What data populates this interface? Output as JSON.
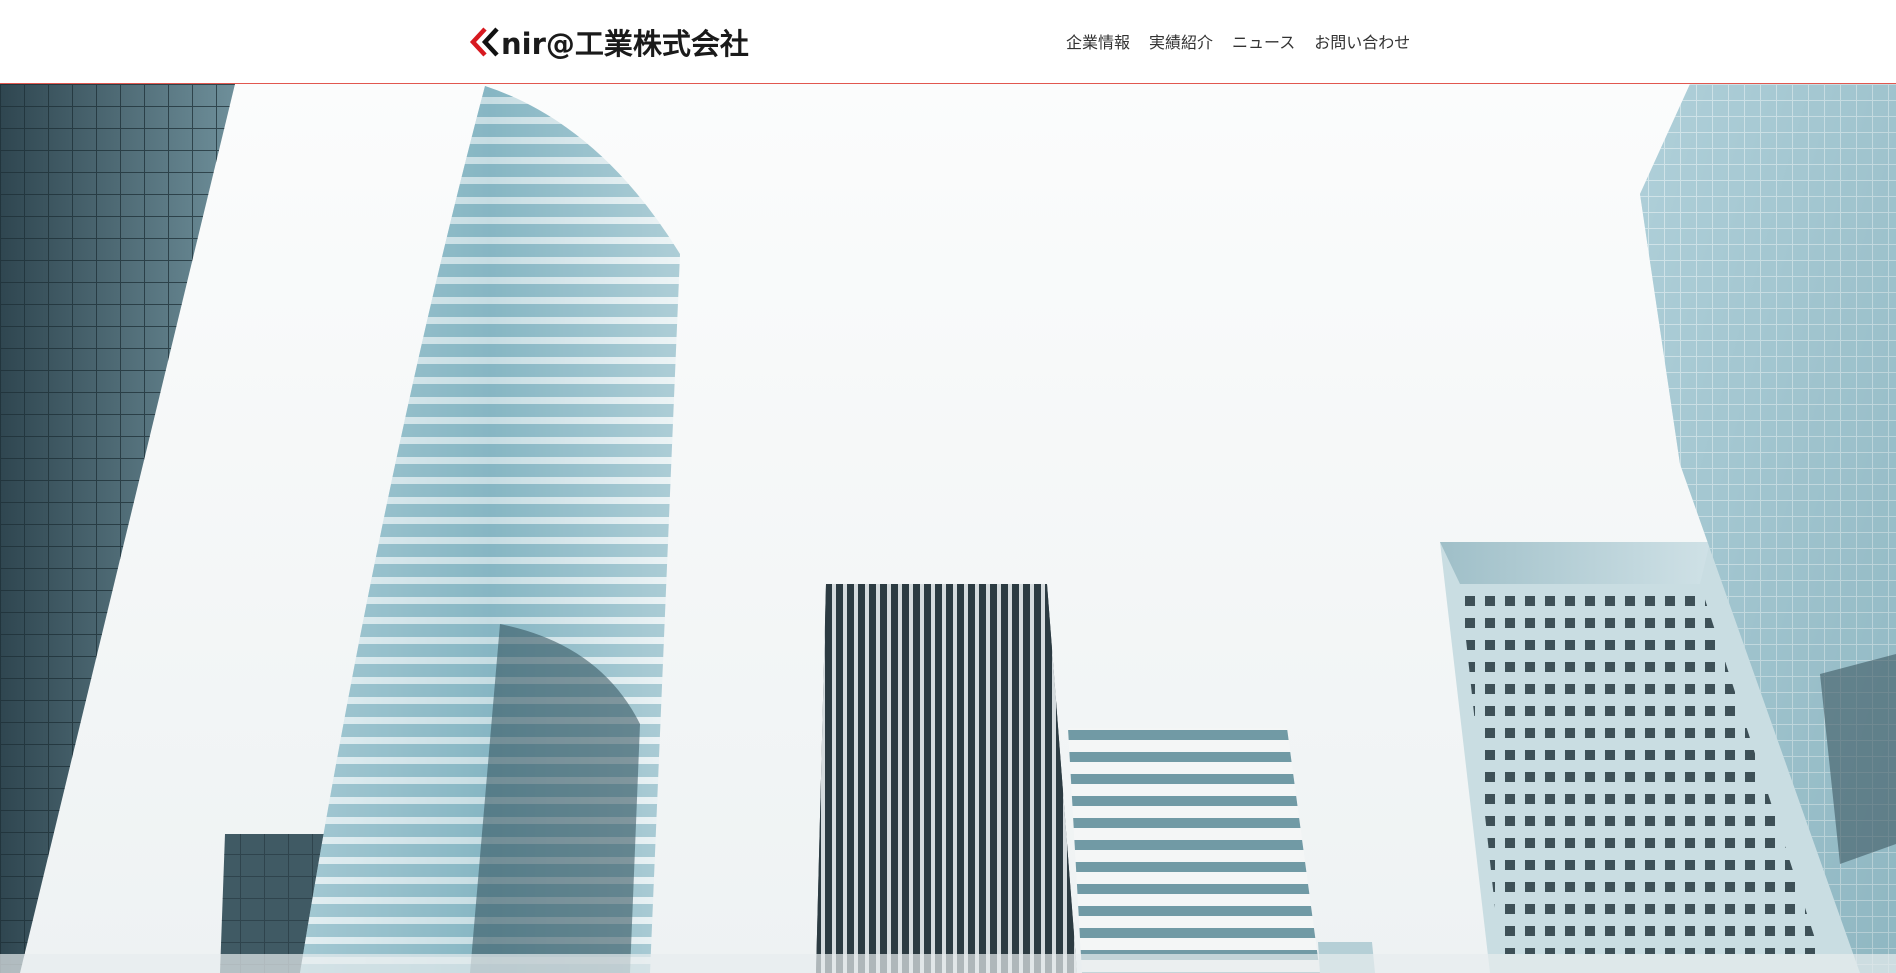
{
  "header": {
    "logo_text": "nir@工業株式会社",
    "accent_color": "#d71920",
    "border_color": "#e1574f"
  },
  "nav": {
    "items": [
      {
        "label": "企業情報"
      },
      {
        "label": "実績紹介"
      },
      {
        "label": "ニュース"
      },
      {
        "label": "お問い合わせ"
      }
    ]
  },
  "hero": {
    "image": "skyscrapers-photo",
    "sky_color": "#f6f8f8"
  }
}
